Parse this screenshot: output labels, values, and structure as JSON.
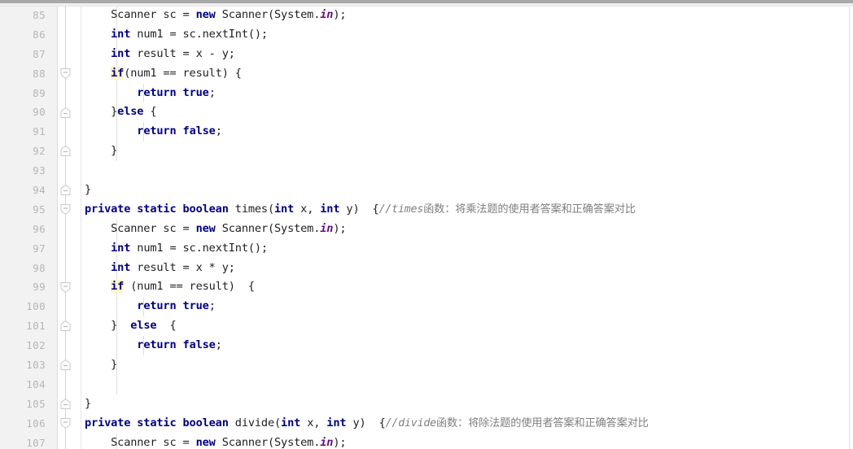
{
  "editor": {
    "name": "java-source-editor",
    "language": "Java",
    "colors": {
      "gutter_background": "#f2f2f2",
      "line_number": "#b6b6b6",
      "keyword": "#000080",
      "static_field": "#660e7a",
      "comment": "#808080",
      "text": "#202020",
      "search_highlight": "#fdf3c8",
      "editor_background": "#ffffff"
    },
    "first_visible_line": 85,
    "last_visible_line": 107,
    "lines": [
      {
        "number": "85",
        "fold": "none",
        "tokens": [
          {
            "t": "    Scanner sc = ",
            "c": "plain"
          },
          {
            "t": "new",
            "c": "kw"
          },
          {
            "t": " Scanner(System.",
            "c": "plain"
          },
          {
            "t": "in",
            "c": "fld"
          },
          {
            "t": ");",
            "c": "plain"
          }
        ]
      },
      {
        "number": "86",
        "fold": "none",
        "tokens": [
          {
            "t": "    ",
            "c": "plain"
          },
          {
            "t": "int",
            "c": "kw"
          },
          {
            "t": " num1 = sc.nextInt();",
            "c": "plain"
          }
        ]
      },
      {
        "number": "87",
        "fold": "none",
        "tokens": [
          {
            "t": "    ",
            "c": "plain"
          },
          {
            "t": "int",
            "c": "kw"
          },
          {
            "t": " result = x - y;",
            "c": "plain"
          }
        ]
      },
      {
        "number": "88",
        "fold": "collapse",
        "tokens": [
          {
            "t": "    ",
            "c": "plain"
          },
          {
            "t": "if",
            "c": "kw hl"
          },
          {
            "t": "(num1 == result) {",
            "c": "plain"
          }
        ]
      },
      {
        "number": "89",
        "fold": "none",
        "tokens": [
          {
            "t": "        ",
            "c": "plain"
          },
          {
            "t": "return",
            "c": "kw"
          },
          {
            "t": " ",
            "c": "plain"
          },
          {
            "t": "true",
            "c": "kw"
          },
          {
            "t": ";",
            "c": "plain"
          }
        ]
      },
      {
        "number": "90",
        "fold": "end",
        "tokens": [
          {
            "t": "    }",
            "c": "plain"
          },
          {
            "t": "else",
            "c": "kw"
          },
          {
            "t": " {",
            "c": "plain"
          }
        ]
      },
      {
        "number": "91",
        "fold": "none",
        "tokens": [
          {
            "t": "        ",
            "c": "plain"
          },
          {
            "t": "return",
            "c": "kw"
          },
          {
            "t": " ",
            "c": "plain"
          },
          {
            "t": "false",
            "c": "kw"
          },
          {
            "t": ";",
            "c": "plain"
          }
        ]
      },
      {
        "number": "92",
        "fold": "end",
        "tokens": [
          {
            "t": "    }",
            "c": "plain"
          }
        ]
      },
      {
        "number": "93",
        "fold": "none",
        "tokens": []
      },
      {
        "number": "94",
        "fold": "end",
        "tokens": [
          {
            "t": "}",
            "c": "plain"
          }
        ]
      },
      {
        "number": "95",
        "fold": "collapse",
        "tokens": [
          {
            "t": "private static boolean",
            "c": "kw"
          },
          {
            "t": " times(",
            "c": "plain"
          },
          {
            "t": "int",
            "c": "kw"
          },
          {
            "t": " x, ",
            "c": "plain"
          },
          {
            "t": "int",
            "c": "kw"
          },
          {
            "t": " y)  {",
            "c": "plain"
          },
          {
            "t": "//times函数：将乘法题的使用者答案和正确答案对比",
            "c": "cmt",
            "mono_prefix": 7
          }
        ]
      },
      {
        "number": "96",
        "fold": "none",
        "tokens": [
          {
            "t": "    Scanner sc = ",
            "c": "plain"
          },
          {
            "t": "new",
            "c": "kw"
          },
          {
            "t": " Scanner(System.",
            "c": "plain"
          },
          {
            "t": "in",
            "c": "fld"
          },
          {
            "t": ");",
            "c": "plain"
          }
        ]
      },
      {
        "number": "97",
        "fold": "none",
        "tokens": [
          {
            "t": "    ",
            "c": "plain"
          },
          {
            "t": "int",
            "c": "kw"
          },
          {
            "t": " num1 = sc.nextInt();",
            "c": "plain"
          }
        ]
      },
      {
        "number": "98",
        "fold": "none",
        "tokens": [
          {
            "t": "    ",
            "c": "plain"
          },
          {
            "t": "int",
            "c": "kw"
          },
          {
            "t": " result = x * y;",
            "c": "plain"
          }
        ]
      },
      {
        "number": "99",
        "fold": "collapse",
        "tokens": [
          {
            "t": "    ",
            "c": "plain"
          },
          {
            "t": "if",
            "c": "kw hl"
          },
          {
            "t": " (num1 == result)  {",
            "c": "plain"
          }
        ]
      },
      {
        "number": "100",
        "fold": "none",
        "tokens": [
          {
            "t": "        ",
            "c": "plain"
          },
          {
            "t": "return",
            "c": "kw"
          },
          {
            "t": " ",
            "c": "plain"
          },
          {
            "t": "true",
            "c": "kw"
          },
          {
            "t": ";",
            "c": "plain"
          }
        ]
      },
      {
        "number": "101",
        "fold": "end",
        "tokens": [
          {
            "t": "    }  ",
            "c": "plain"
          },
          {
            "t": "else",
            "c": "kw"
          },
          {
            "t": "  {",
            "c": "plain"
          }
        ]
      },
      {
        "number": "102",
        "fold": "none",
        "tokens": [
          {
            "t": "        ",
            "c": "plain"
          },
          {
            "t": "return",
            "c": "kw"
          },
          {
            "t": " ",
            "c": "plain"
          },
          {
            "t": "false",
            "c": "kw"
          },
          {
            "t": ";",
            "c": "plain"
          }
        ]
      },
      {
        "number": "103",
        "fold": "end",
        "tokens": [
          {
            "t": "    }",
            "c": "plain"
          }
        ]
      },
      {
        "number": "104",
        "fold": "none",
        "tokens": []
      },
      {
        "number": "105",
        "fold": "end",
        "tokens": [
          {
            "t": "}",
            "c": "plain"
          }
        ]
      },
      {
        "number": "106",
        "fold": "collapse",
        "tokens": [
          {
            "t": "private static boolean",
            "c": "kw"
          },
          {
            "t": " divide(",
            "c": "plain"
          },
          {
            "t": "int",
            "c": "kw"
          },
          {
            "t": " x, ",
            "c": "plain"
          },
          {
            "t": "int",
            "c": "kw"
          },
          {
            "t": " y)  {",
            "c": "plain"
          },
          {
            "t": "//divide函数：将除法题的使用者答案和正确答案对比",
            "c": "cmt",
            "mono_prefix": 8
          }
        ]
      },
      {
        "number": "107",
        "fold": "none",
        "tokens": [
          {
            "t": "    Scanner sc = ",
            "c": "plain"
          },
          {
            "t": "new",
            "c": "kw"
          },
          {
            "t": " Scanner(System.",
            "c": "plain"
          },
          {
            "t": "in",
            "c": "fld"
          },
          {
            "t": ");",
            "c": "plain"
          }
        ]
      }
    ]
  }
}
